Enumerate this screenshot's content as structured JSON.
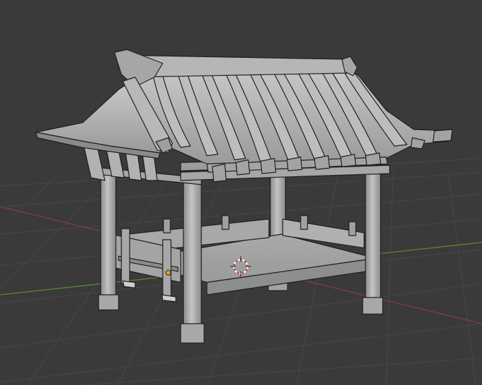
{
  "viewport": {
    "background": "#3a3a3a",
    "grid_color": "#474747",
    "x_axis_color": "#8b3a44",
    "y_axis_color": "#5a8a2a"
  },
  "scene": {
    "model": "pavilion",
    "material_color": "#b8b8b8",
    "edge_color": "#1e1e1e"
  },
  "overlays": {
    "cursor": "3d-cursor",
    "origin_color": "#f0a020"
  }
}
